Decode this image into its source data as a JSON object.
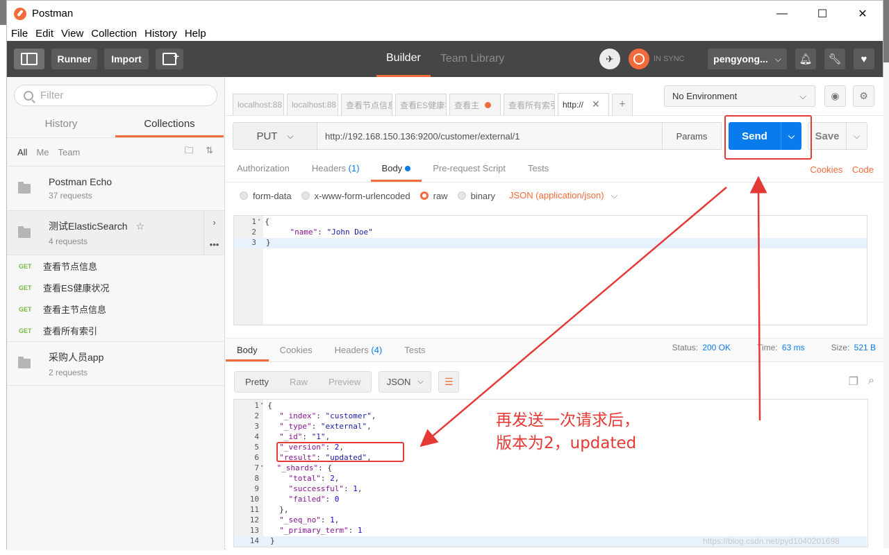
{
  "app": {
    "title": "Postman"
  },
  "window_controls": [
    "—",
    "☐",
    "✕"
  ],
  "menu": [
    "File",
    "Edit",
    "View",
    "Collection",
    "History",
    "Help"
  ],
  "toolbar": {
    "runner": "Runner",
    "import": "Import",
    "tabs": [
      {
        "label": "Builder",
        "active": true
      },
      {
        "label": "Team Library",
        "active": false
      }
    ],
    "sync_status": "IN SYNC",
    "user": "pengyong..."
  },
  "sidebar": {
    "filter_placeholder": "Filter",
    "tabs": [
      {
        "label": "History",
        "active": false
      },
      {
        "label": "Collections",
        "active": true
      }
    ],
    "filters": [
      "All",
      "Me",
      "Team"
    ],
    "collections": [
      {
        "name": "Postman Echo",
        "count": "37 requests"
      },
      {
        "name": "测试ElasticSearch",
        "count": "4 requests"
      }
    ],
    "requests": [
      {
        "method": "GET",
        "name": "查看节点信息"
      },
      {
        "method": "GET",
        "name": "查看ES健康状况"
      },
      {
        "method": "GET",
        "name": "查看主节点信息"
      },
      {
        "method": "GET",
        "name": "查看所有索引"
      }
    ],
    "collection3": {
      "name": "采购人员app",
      "count": "2 requests"
    }
  },
  "request_tabs": [
    {
      "label": "localhost:88"
    },
    {
      "label": "localhost:88"
    },
    {
      "label": "查看节点信息"
    },
    {
      "label": "查看ES健康状"
    },
    {
      "label": "查看主"
    },
    {
      "label": "查看所有索引"
    },
    {
      "label": "http://"
    }
  ],
  "environment": {
    "selected": "No Environment"
  },
  "request": {
    "method": "PUT",
    "url": "http://192.168.150.136:9200/customer/external/1",
    "params_label": "Params",
    "send_label": "Send",
    "save_label": "Save"
  },
  "request_sub_tabs": {
    "authorization": "Authorization",
    "headers": "Headers",
    "headers_count": "(1)",
    "body": "Body",
    "prerequest": "Pre-request Script",
    "tests": "Tests",
    "cookies": "Cookies",
    "code": "Code"
  },
  "body_options": {
    "form_data": "form-data",
    "urlencoded": "x-www-form-urlencoded",
    "raw": "raw",
    "binary": "binary",
    "content_type": "JSON (application/json)"
  },
  "request_body": {
    "line_numbers": [
      "1",
      "2",
      "3"
    ],
    "l1": "{",
    "l2_key": "\"name\"",
    "l2_val": "\"John Doe\"",
    "l3": "}"
  },
  "response_tabs": {
    "body": "Body",
    "cookies": "Cookies",
    "headers": "Headers",
    "headers_count": "(4)",
    "tests": "Tests"
  },
  "response_status": {
    "status_label": "Status:",
    "status": "200 OK",
    "time_label": "Time:",
    "time": "63 ms",
    "size_label": "Size:",
    "size": "521 B"
  },
  "response_view": {
    "modes": [
      "Pretty",
      "Raw",
      "Preview"
    ],
    "format": "JSON"
  },
  "response_body": {
    "line_numbers": [
      "1",
      "2",
      "3",
      "4",
      "5",
      "6",
      "7",
      "8",
      "9",
      "10",
      "11",
      "12",
      "13",
      "14"
    ],
    "index_key": "\"_index\"",
    "index_val": "\"customer\"",
    "type_key": "\"_type\"",
    "type_val": "\"external\"",
    "id_key": "\"_id\"",
    "id_val": "\"1\"",
    "version_key": "\"_version\"",
    "version_val": "2",
    "result_key": "\"result\"",
    "result_val": "\"updated\"",
    "shards_key": "\"_shards\"",
    "total_key": "\"total\"",
    "total_val": "2",
    "successful_key": "\"successful\"",
    "successful_val": "1",
    "failed_key": "\"failed\"",
    "failed_val": "0",
    "seq_key": "\"_seq_no\"",
    "seq_val": "1",
    "term_key": "\"_primary_term\"",
    "term_val": "1"
  },
  "annotation": {
    "line1": "再发送一次请求后，",
    "line2": "版本为2，updated",
    "color": "#e53935"
  },
  "watermark": "https://blog.csdn.net/pyd1040201698",
  "colors": {
    "accent": "#f26b3a",
    "primary": "#097bed",
    "toolbar": "#464646",
    "get": "#75b843"
  }
}
